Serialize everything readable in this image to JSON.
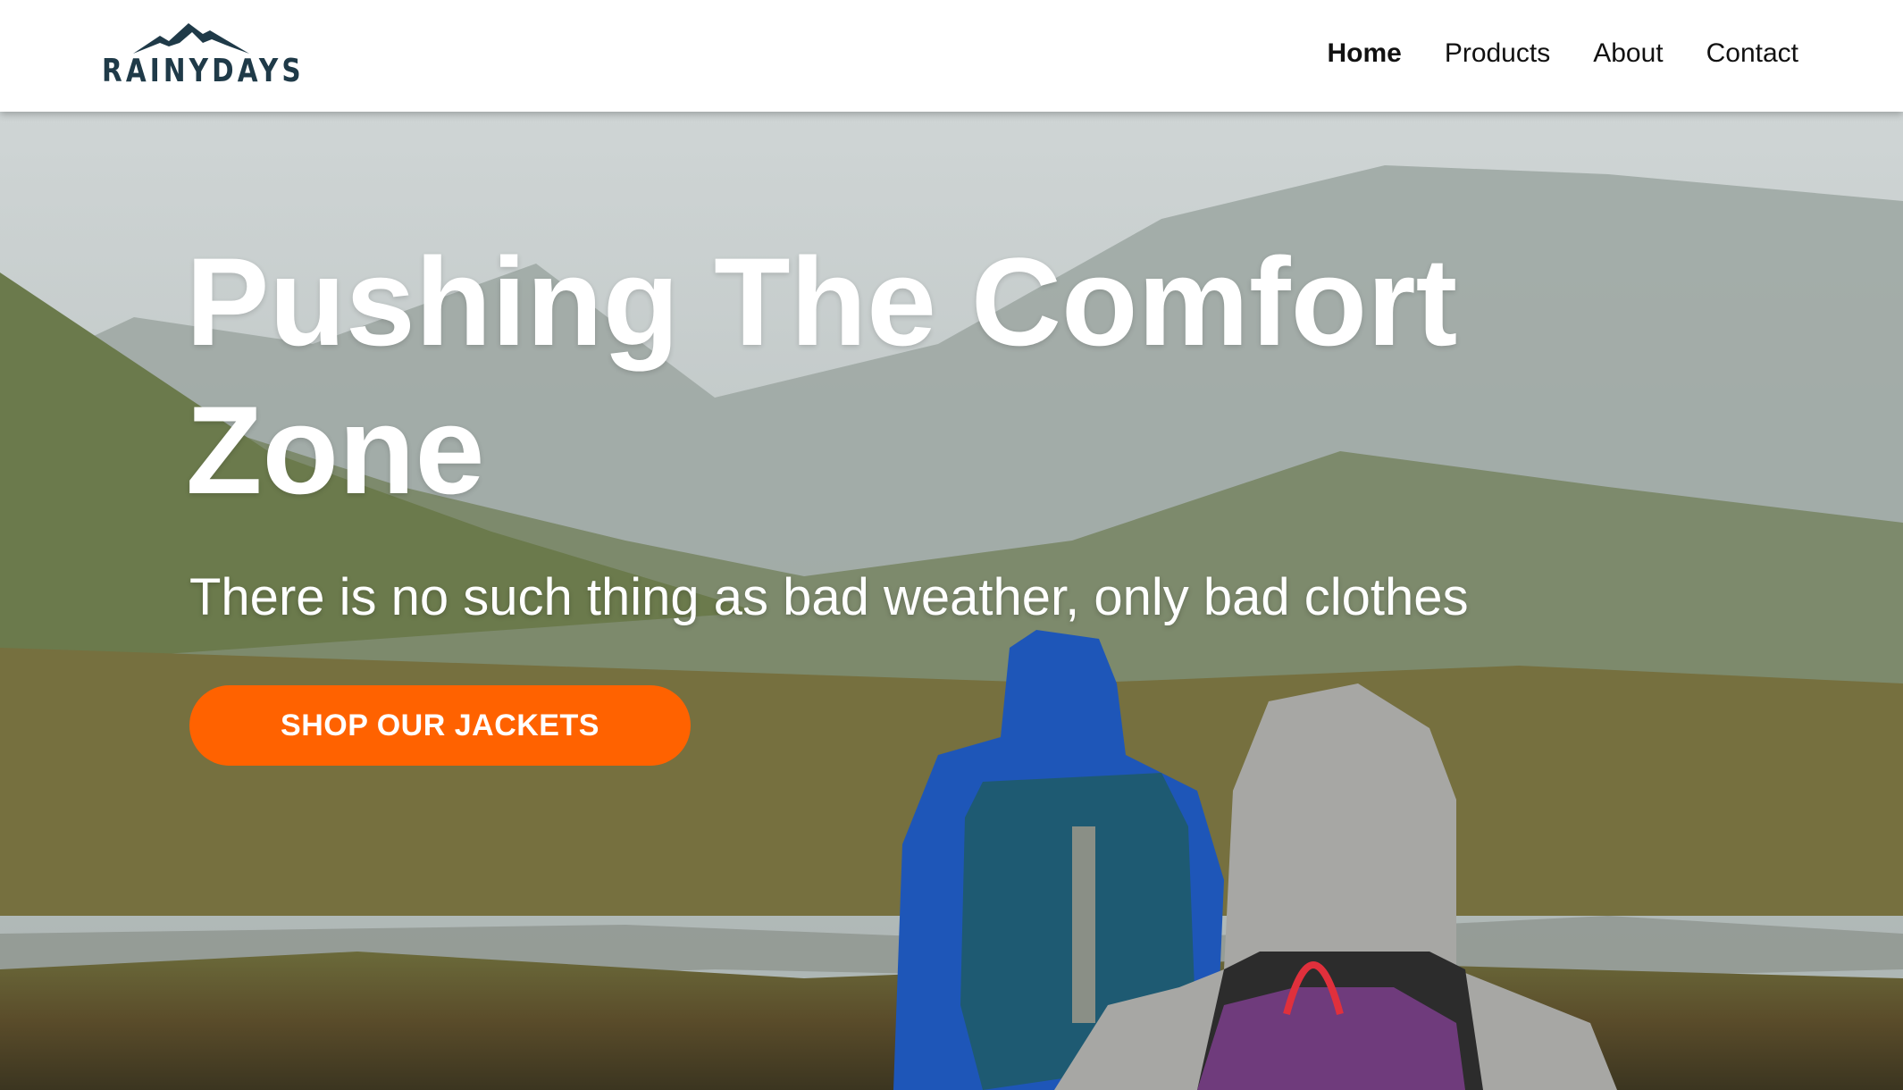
{
  "header": {
    "logo_text": "RAINYDAYS",
    "nav": [
      {
        "label": "Home",
        "active": true
      },
      {
        "label": "Products",
        "active": false
      },
      {
        "label": "About",
        "active": false
      },
      {
        "label": "Contact",
        "active": false
      }
    ]
  },
  "hero": {
    "title": "Pushing The Comfort Zone",
    "subtitle": "There is no such thing as bad weather, only bad clothes",
    "cta_label": "SHOP OUR JACKETS"
  },
  "colors": {
    "accent": "#ff6200",
    "logo": "#1f3a48",
    "header_bg": "#ffffff"
  }
}
